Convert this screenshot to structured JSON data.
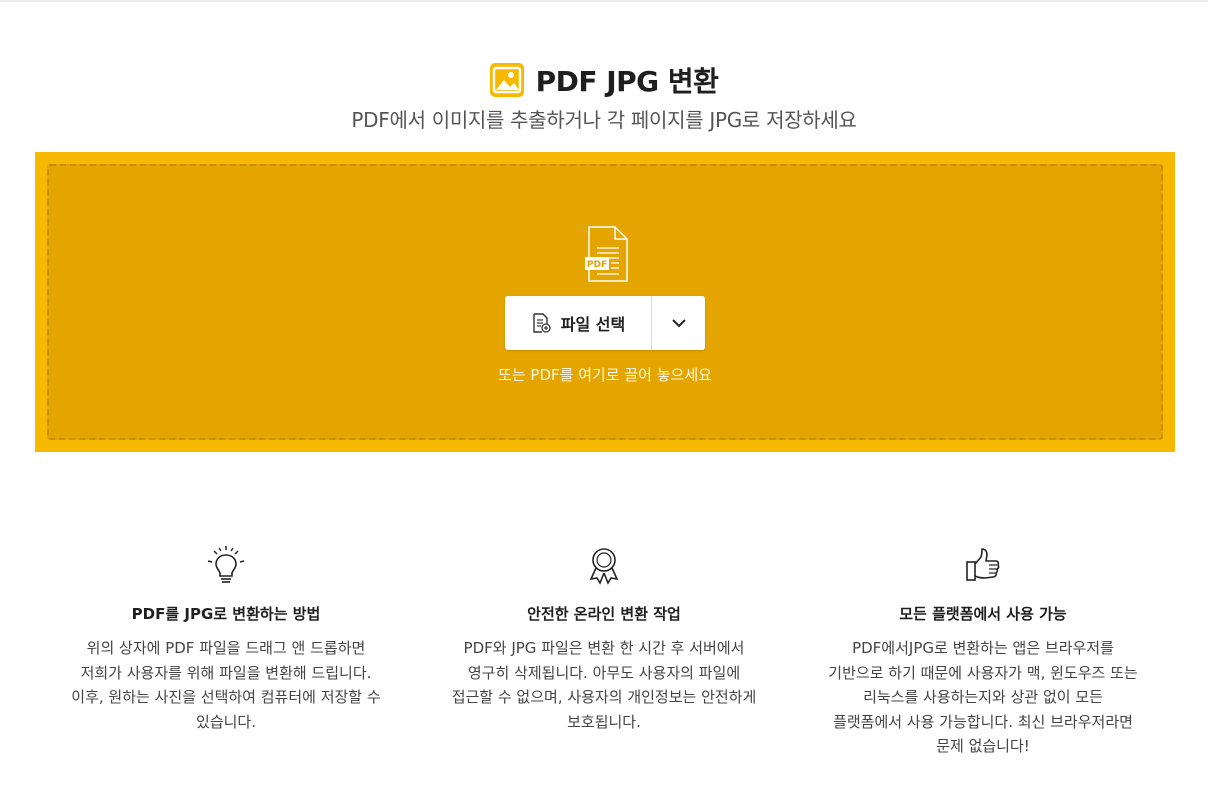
{
  "header": {
    "title": "PDF JPG 변환",
    "subtitle": "PDF에서 이미지를 추출하거나 각 페이지를 JPG로 저장하세요"
  },
  "dropzone": {
    "file_icon_label": "PDF",
    "select_button_label": "파일 선택",
    "hint": "또는 PDF를 여기로 끌어 놓으세요"
  },
  "features": [
    {
      "icon": "lightbulb-icon",
      "title": "PDF를 JPG로 변환하는 방법",
      "text": "위의 상자에 PDF 파일을 드래그 앤 드롭하면 저희가 사용자를 위해 파일을 변환해 드립니다. 이후, 원하는 사진을 선택하여 컴퓨터에 저장할 수 있습니다."
    },
    {
      "icon": "award-ribbon-icon",
      "title": "안전한 온라인 변환 작업",
      "text": "PDF와 JPG 파일은 변환 한 시간 후 서버에서 영구히 삭제됩니다. 아무도 사용자의 파일에 접근할 수 없으며, 사용자의 개인정보는 안전하게 보호됩니다."
    },
    {
      "icon": "thumbs-up-icon",
      "title": "모든 플랫폼에서 사용 가능",
      "text": "PDF에서JPG로 변환하는 앱은 브라우저를 기반으로 하기 때문에 사용자가 맥, 윈도우즈 또는 리눅스를 사용하는지와 상관 없이 모든 플랫폼에서 사용 가능합니다. 최신 브라우저라면 문제 없습니다!"
    }
  ],
  "colors": {
    "accent": "#f6b900",
    "dropzone_inner": "#e5a500"
  }
}
